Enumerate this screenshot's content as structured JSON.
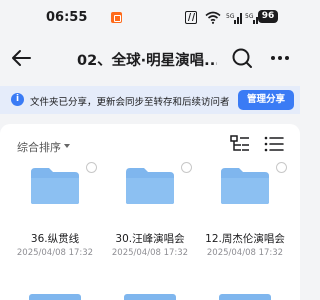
{
  "status_bar": {
    "time": "06:55",
    "battery": "96",
    "icons": [
      "nfc-icon",
      "wifi-icon",
      "signal-icon",
      "signal-icon",
      "battery-icon"
    ]
  },
  "header": {
    "title": "02、全球·明星演唱..."
  },
  "notice": {
    "text": "文件夹已分享，更新会同步至转存和后续访问者",
    "button": "管理分享"
  },
  "toolbar": {
    "sort_label": "综合排序"
  },
  "colors": {
    "accent": "#3a7bf5",
    "folder": "#7fb6ee",
    "notice_bg": "#e5ecfa"
  },
  "folders": [
    {
      "name": "36.纵贯线",
      "date": "2025/04/08 17:32"
    },
    {
      "name": "30.汪峰演唱会",
      "date": "2025/04/08 17:32"
    },
    {
      "name": "12.周杰伦演唱会",
      "date": "2025/04/08 17:32"
    }
  ]
}
